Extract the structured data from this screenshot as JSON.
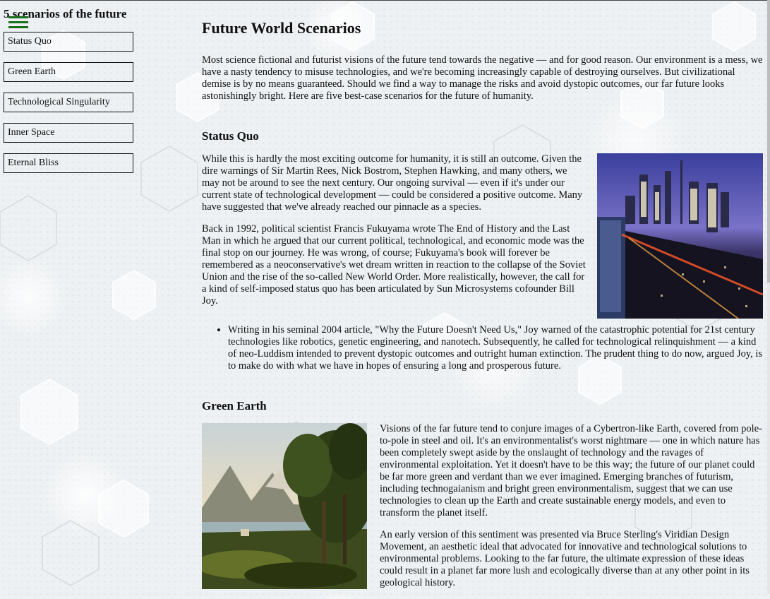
{
  "sidebar": {
    "title": "5 scenarios of the future",
    "items": [
      {
        "label": "Status Quo"
      },
      {
        "label": "Green Earth"
      },
      {
        "label": "Technological Singularity"
      },
      {
        "label": "Inner Space"
      },
      {
        "label": "Eternal Bliss"
      }
    ]
  },
  "main": {
    "title": "Future World Scenarios",
    "intro": "Most science fictional and futurist visions of the future tend towards the negative — and for good reason. Our environment is a mess, we have a nasty tendency to misuse technologies, and we're becoming increasingly capable of destroying ourselves. But civilizational demise is by no means guaranteed. Should we find a way to manage the risks and avoid dystopic outcomes, our far future looks astonishingly bright. Here are five best-case scenarios for the future of humanity.",
    "sections": [
      {
        "heading": "Status Quo",
        "paragraphs": [
          "While this is hardly the most exciting outcome for humanity, it is still an outcome. Given the dire warnings of Sir Martin Rees, Nick Bostrom, Stephen Hawking, and many others, we may not be around to see the next century. Our ongoing survival — even if it's under our current state of technological development — could be considered a positive outcome. Many have suggested that we've already reached our pinnacle as a species.",
          "Back in 1992, political scientist Francis Fukuyama wrote The End of History and the Last Man in which he argued that our current political, technological, and economic mode was the final stop on our journey. He was wrong, of course; Fukuyama's book will forever be remembered as a neoconservative's wet dream written in reaction to the collapse of the Soviet Union and the rise of the so-called New World Order. More realistically, however, the call for a kind of self-imposed status quo has been articulated by Sun Microsystems cofounder Bill Joy."
        ],
        "bullets": [
          "Writing in his seminal 2004 article, \"Why the Future Doesn't Need Us,\" Joy warned of the catastrophic potential for 21st century technologies like robotics, genetic engineering, and nanotech. Subsequently, he called for technological relinquishment — a kind of neo-Luddism intended to prevent dystopic outcomes and outright human extinction. The prudent thing to do now, argued Joy, is to make do with what we have in hopes of ensuring a long and prosperous future."
        ]
      },
      {
        "heading": "Green Earth",
        "paragraphs": [
          "Visions of the far future tend to conjure images of a Cybertron-like Earth, covered from pole-to-pole in steel and oil. It's an environmentalist's worst nightmare — one in which nature has been completely swept aside by the onslaught of technology and the ravages of environmental exploitation. Yet it doesn't have to be this way; the future of our planet could be far more green and verdant than we ever imagined. Emerging branches of futurism, including technogaianism and bright green environmentalism, suggest that we can use technologies to clean up the Earth and create sustainable energy models, and even to transform the planet itself.",
          "An early version of this sentiment was presented via Bruce Sterling's Viridian Design Movement, an aesthetic ideal that advocated for innovative and technological solutions to environmental problems. Looking to the far future, the ultimate expression of these ideas could result in a planet far more lush and ecologically diverse than at any other point in its geological history."
        ]
      }
    ]
  }
}
